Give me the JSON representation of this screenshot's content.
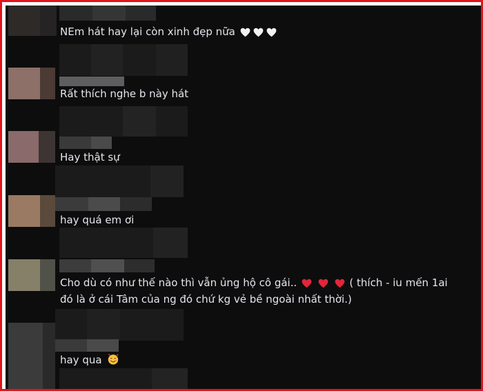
{
  "comments": [
    {
      "text": "NEm hát hay lại còn xinh đẹp nữa",
      "emoji": [
        "white-heart",
        "white-heart",
        "white-heart"
      ]
    },
    {
      "text": "Rất thích nghe b này hát"
    },
    {
      "text": "Hay thật sự"
    },
    {
      "text": "hay quá em ơi"
    },
    {
      "text_prefix": "Cho dù có như thế nào thì vẫn ủng hộ cô gái..",
      "emoji": [
        "red-heart",
        "red-heart",
        "red-heart"
      ],
      "text_suffix": "( thích - iu mến 1ai",
      "text_line2": "đó là ở cái Tâm của ng đó chứ kg vẻ bề ngoài nhất thời.)"
    },
    {
      "text": "hay qua",
      "emoji": [
        "smiling-face-with-hearts"
      ]
    }
  ],
  "colors": {
    "frame": "#e0151b",
    "panel": "#0d0d0e",
    "text": "#e4e6eb",
    "red_heart": "#e0263a",
    "white_heart": "#f2f2f2"
  }
}
